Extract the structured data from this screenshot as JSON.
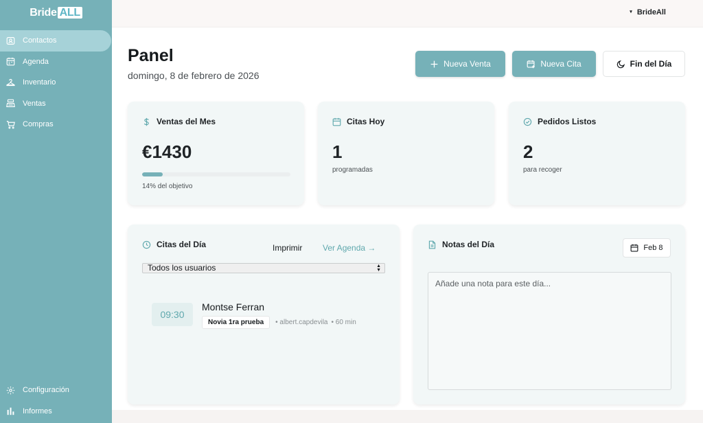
{
  "brand": {
    "name": "Bride",
    "badge": "ALL"
  },
  "sidebar": {
    "items": [
      {
        "label": "Contactos",
        "icon": "contact-card-icon",
        "active": true
      },
      {
        "label": "Agenda",
        "icon": "calendar-icon"
      },
      {
        "label": "Inventario",
        "icon": "hanger-icon"
      },
      {
        "label": "Ventas",
        "icon": "register-icon"
      },
      {
        "label": "Compras",
        "icon": "cart-icon"
      }
    ],
    "bottom": [
      {
        "label": "Configuración",
        "icon": "gear-icon"
      },
      {
        "label": "Informes",
        "icon": "bar-chart-icon"
      }
    ]
  },
  "header": {
    "user": "BrideAll"
  },
  "page": {
    "title": "Panel",
    "date": "domingo, 8 de febrero de 2026"
  },
  "actions": {
    "new_sale": "Nueva Venta",
    "new_appointment": "Nueva Cita",
    "end_day": "Fin del Día"
  },
  "stats": {
    "sales": {
      "title": "Ventas del Mes",
      "value": "€1430",
      "sub": "14% del objetivo",
      "progress_pct": 14
    },
    "appointments": {
      "title": "Citas Hoy",
      "value": "1",
      "sub": "programadas"
    },
    "orders": {
      "title": "Pedidos Listos",
      "value": "2",
      "sub": "para recoger"
    }
  },
  "day_appointments": {
    "title": "Citas del Día",
    "print": "Imprimir",
    "view_agenda": "Ver Agenda →",
    "filter_value": "Todos los usuarios",
    "items": [
      {
        "time": "09:30",
        "name": "Montse Ferran",
        "type": "Novia 1ra prueba",
        "user": "• albert.capdevila",
        "duration": "• 60 min"
      }
    ]
  },
  "notes": {
    "title": "Notas del Día",
    "date_chip": "Feb 8",
    "placeholder": "Añade una nota para este día..."
  },
  "colors": {
    "sidebar": "#76b1b8",
    "accent": "#76b1b8",
    "card": "#f2f7f7",
    "brand_badge": "#5fb6c6"
  }
}
